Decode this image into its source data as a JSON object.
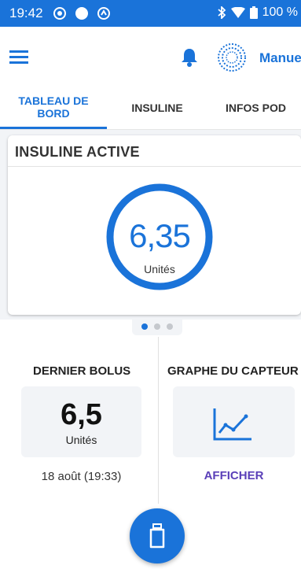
{
  "status_bar": {
    "time": "19:42",
    "battery_percent": "100 %"
  },
  "app_bar": {
    "mode_label": "Manuel"
  },
  "tabs": [
    {
      "label": "TABLEAU DE BORD",
      "active": true
    },
    {
      "label": "INSULINE",
      "active": false
    },
    {
      "label": "INFOS POD",
      "active": false
    }
  ],
  "active_insulin": {
    "title": "INSULINE ACTIVE",
    "value": "6,35",
    "unit": "Unités"
  },
  "pagination": {
    "page_count": 3,
    "current": 1
  },
  "last_bolus": {
    "title": "DERNIER BOLUS",
    "value": "6,5",
    "unit": "Unités",
    "time": "18 août (19:33)"
  },
  "sensor_graph": {
    "title": "GRAPHE DU CAPTEUR",
    "action": "AFFICHER"
  },
  "colors": {
    "primary": "#1a73d9",
    "accent_purple": "#5a3fb8",
    "panel_bg": "#f2f4f7"
  }
}
